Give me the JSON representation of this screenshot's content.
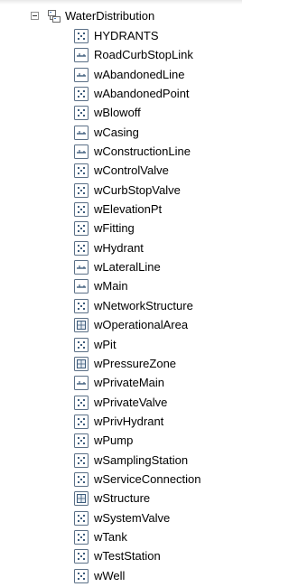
{
  "group": {
    "label": "WaterDistribution",
    "icon": "feature-dataset-icon"
  },
  "items": [
    {
      "label": "HYDRANTS",
      "type": "point"
    },
    {
      "label": "RoadCurbStopLink",
      "type": "line"
    },
    {
      "label": "wAbandonedLine",
      "type": "line"
    },
    {
      "label": "wAbandonedPoint",
      "type": "point"
    },
    {
      "label": "wBlowoff",
      "type": "point"
    },
    {
      "label": "wCasing",
      "type": "line"
    },
    {
      "label": "wConstructionLine",
      "type": "line"
    },
    {
      "label": "wControlValve",
      "type": "point"
    },
    {
      "label": "wCurbStopValve",
      "type": "point"
    },
    {
      "label": "wElevationPt",
      "type": "point"
    },
    {
      "label": "wFitting",
      "type": "point"
    },
    {
      "label": "wHydrant",
      "type": "point"
    },
    {
      "label": "wLateralLine",
      "type": "line"
    },
    {
      "label": "wMain",
      "type": "line"
    },
    {
      "label": "wNetworkStructure",
      "type": "point"
    },
    {
      "label": "wOperationalArea",
      "type": "polygon"
    },
    {
      "label": "wPit",
      "type": "point"
    },
    {
      "label": "wPressureZone",
      "type": "polygon"
    },
    {
      "label": "wPrivateMain",
      "type": "line"
    },
    {
      "label": "wPrivateValve",
      "type": "point"
    },
    {
      "label": "wPrivHydrant",
      "type": "point"
    },
    {
      "label": "wPump",
      "type": "point"
    },
    {
      "label": "wSamplingStation",
      "type": "point"
    },
    {
      "label": "wServiceConnection",
      "type": "point"
    },
    {
      "label": "wStructure",
      "type": "polygon"
    },
    {
      "label": "wSystemValve",
      "type": "point"
    },
    {
      "label": "wTank",
      "type": "point"
    },
    {
      "label": "wTestStation",
      "type": "point"
    },
    {
      "label": "wWell",
      "type": "point"
    }
  ]
}
